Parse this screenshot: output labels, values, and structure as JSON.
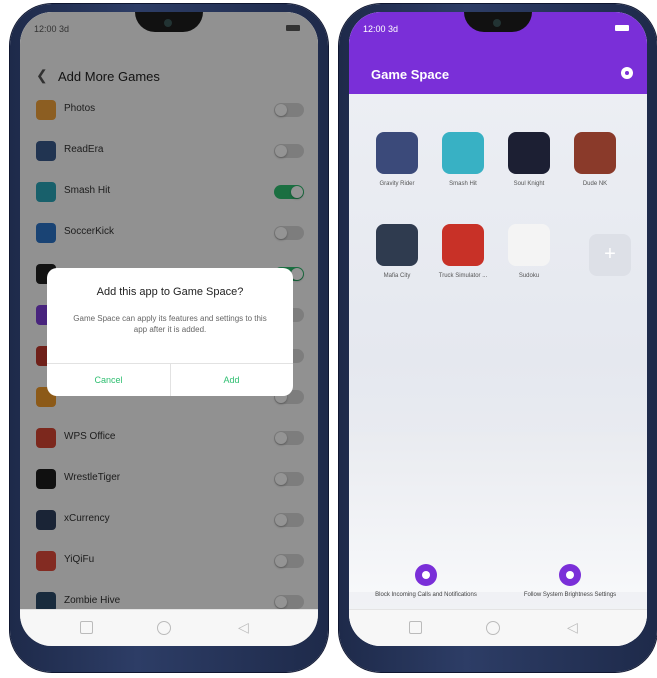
{
  "colors": {
    "accent_purple": "#7a2fd8",
    "toggle_on": "#2fbf71",
    "dialog_button": "#2fbf71"
  },
  "left": {
    "status_time": "12:00 3d",
    "title": "Add More Games",
    "back_icon": "chevron-left-icon",
    "apps": [
      {
        "name": "Photos",
        "icon_color": "#f1a33b",
        "on": false
      },
      {
        "name": "ReadEra",
        "icon_color": "#3a5a8c",
        "on": false
      },
      {
        "name": "Smash Hit",
        "icon_color": "#2aa6b8",
        "on": true
      },
      {
        "name": "SoccerKick",
        "icon_color": "#2b74c9",
        "on": false
      },
      {
        "name": "",
        "icon_color": "#222222",
        "on": true
      },
      {
        "name": "",
        "icon_color": "#7c3fd8",
        "on": false
      },
      {
        "name": "",
        "icon_color": "#c0382b",
        "on": false
      },
      {
        "name": "",
        "icon_color": "#f29b2a",
        "on": false
      },
      {
        "name": "WPS Office",
        "icon_color": "#d64533",
        "on": false
      },
      {
        "name": "WrestleTiger",
        "icon_color": "#1c1c1c",
        "on": false
      },
      {
        "name": "xCurrency",
        "icon_color": "#2d3f5e",
        "on": false
      },
      {
        "name": "YiQiFu",
        "icon_color": "#e24a3b",
        "on": false
      },
      {
        "name": "Zombie Hive",
        "icon_color": "#2c4a6a",
        "on": false
      }
    ],
    "dialog": {
      "title": "Add this app to Game Space?",
      "message": "Game Space can apply its features and settings to this app after it is added.",
      "cancel": "Cancel",
      "add": "Add"
    }
  },
  "right": {
    "status_time": "12:00 3d",
    "title": "Game Space",
    "games": [
      {
        "name": "Gravity Rider",
        "icon_color": "#3b4a7a"
      },
      {
        "name": "Smash Hit",
        "icon_color": "#38b1c4"
      },
      {
        "name": "Soul Knight",
        "icon_color": "#1c1f33"
      },
      {
        "name": "Dude NK",
        "icon_color": "#8a3a2a"
      },
      {
        "name": "Mafia City",
        "icon_color": "#2f3b4f"
      },
      {
        "name": "Truck Simulator ...",
        "icon_color": "#c83127"
      },
      {
        "name": "Sudoku",
        "icon_color": "#f4f4f4"
      }
    ],
    "add_tile": "+",
    "features": [
      {
        "label": "Block Incoming Calls and Notifications"
      },
      {
        "label": "Follow System Brightness Settings"
      }
    ]
  }
}
